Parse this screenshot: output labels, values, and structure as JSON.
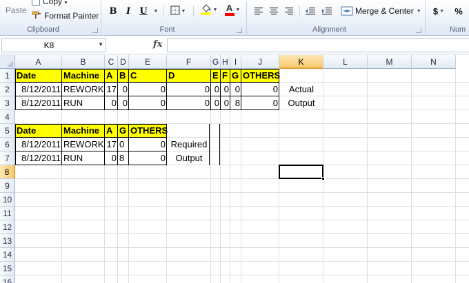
{
  "ribbon": {
    "clipboard": {
      "paste_label": "Paste",
      "copy_label": "Copy",
      "format_painter_label": "Format Painter",
      "group_label": "Clipboard"
    },
    "font": {
      "bold": "B",
      "italic": "I",
      "underline": "U",
      "group_label": "Font",
      "font_color_letter": "A",
      "fill_color": "#ffff00",
      "font_color": "#ff0000"
    },
    "alignment": {
      "merge_center_label": "Merge & Center",
      "group_label": "Alignment"
    },
    "number": {
      "currency_symbol": "$",
      "percent_symbol": "%",
      "group_label": "Num"
    }
  },
  "formula_bar": {
    "name_box": "K8",
    "fx_label": "fx",
    "formula": ""
  },
  "columns": [
    "A",
    "B",
    "C",
    "D",
    "E",
    "F",
    "G",
    "H",
    "I",
    "J",
    "K",
    "L",
    "M",
    "N"
  ],
  "rows": [
    "1",
    "2",
    "3",
    "4",
    "5",
    "6",
    "7",
    "8",
    "9",
    "10",
    "11",
    "12",
    "13",
    "14",
    "15",
    "16"
  ],
  "selected_cell": {
    "column": "K",
    "row": "8"
  },
  "table1": {
    "headers": [
      "Date",
      "Machine",
      "A",
      "B",
      "C",
      "D",
      "E",
      "F",
      "G",
      "OTHERS"
    ],
    "rows": [
      [
        "8/12/2011",
        "REWORK",
        "17",
        "0",
        "0",
        "0",
        "0",
        "0",
        "0",
        "0"
      ],
      [
        "8/12/2011",
        "RUN",
        "0",
        "0",
        "0",
        "0",
        "0",
        "0",
        "8",
        "0"
      ]
    ],
    "side_label": [
      "Actual",
      "Output"
    ]
  },
  "table2": {
    "headers": [
      "Date",
      "Machine",
      "A",
      "G",
      "OTHERS"
    ],
    "rows": [
      [
        "8/12/2011",
        "REWORK",
        "17",
        "0",
        "0"
      ],
      [
        "8/12/2011",
        "RUN",
        "0",
        "8",
        "0"
      ]
    ],
    "side_label": [
      "Required",
      "Output"
    ]
  },
  "colors": {
    "header_fill": "#ffff00",
    "selected_header": "#f7c96f"
  }
}
